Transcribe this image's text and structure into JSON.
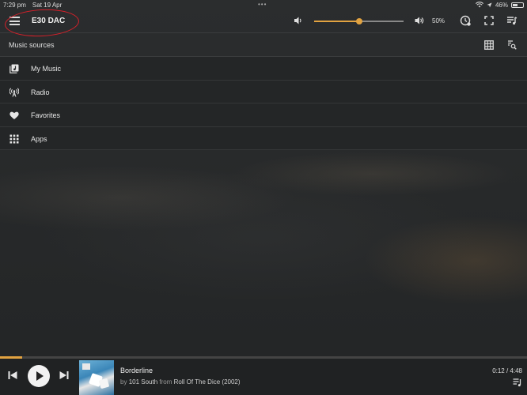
{
  "status": {
    "time": "7:29 pm",
    "date": "Sat 19 Apr",
    "battery": "46%"
  },
  "header": {
    "device_name": "E30 DAC",
    "volume_percent_label": "50%",
    "volume_level": 0.5,
    "accent_color": "#e2a341",
    "annotation_color": "#d8202a"
  },
  "section": {
    "title": "Music sources"
  },
  "sources": [
    {
      "label": "My Music",
      "icon": "music-library-icon"
    },
    {
      "label": "Radio",
      "icon": "radio-antenna-icon"
    },
    {
      "label": "Favorites",
      "icon": "heart-icon"
    },
    {
      "label": "Apps",
      "icon": "apps-grid-icon"
    }
  ],
  "player": {
    "title": "Borderline",
    "by_prefix": "by",
    "artist": "101 South",
    "from_prefix": "from",
    "album": "Roll Of The Dice (2002)",
    "time": "0:12 / 4:48",
    "progress": 0.042
  }
}
